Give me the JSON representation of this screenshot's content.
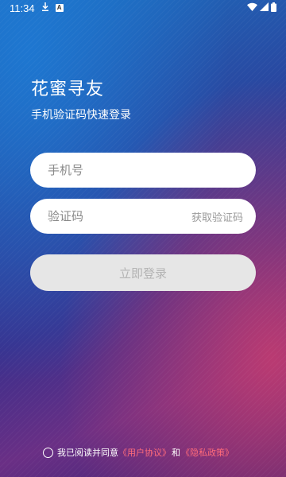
{
  "status_bar": {
    "time": "11:34",
    "icons": [
      "download-icon",
      "a-badge-icon",
      "wifi-icon",
      "signal-icon",
      "battery-icon"
    ],
    "a_badge": "A"
  },
  "header": {
    "title": "花蜜寻友",
    "subtitle": "手机验证码快速登录"
  },
  "form": {
    "phone": {
      "value": "",
      "placeholder": "手机号"
    },
    "code": {
      "value": "",
      "placeholder": "验证码",
      "get_code_label": "获取验证码"
    },
    "login_label": "立即登录"
  },
  "agreement": {
    "checked": false,
    "prefix": "我已阅读并同意",
    "user_agreement": "《用户协议》",
    "and": "和",
    "privacy_policy": "《隐私政策》"
  },
  "colors": {
    "link": "#ff6b7a",
    "button_bg": "#e6e6e6",
    "button_text": "#b3b3b3"
  }
}
